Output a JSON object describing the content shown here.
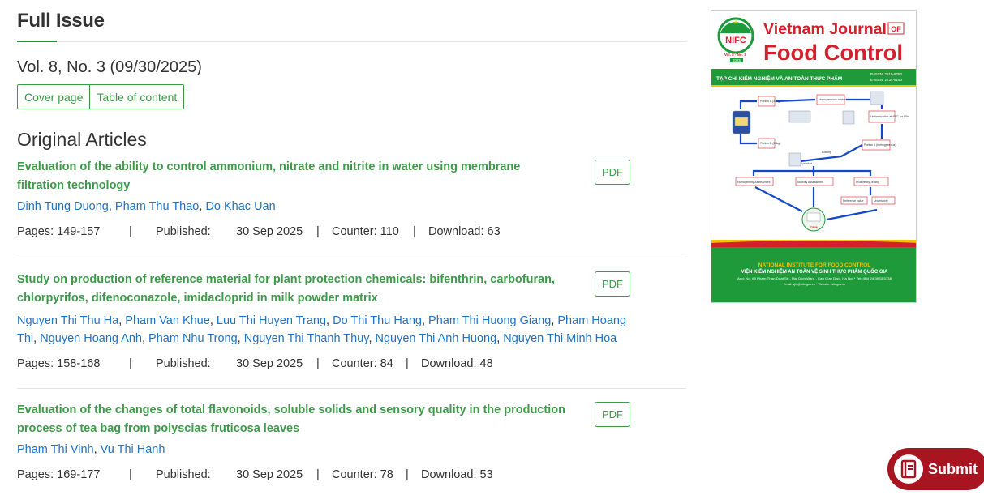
{
  "page": {
    "title": "Full Issue",
    "issue": "Vol. 8, No. 3 (09/30/2025)",
    "buttons": [
      "Cover page",
      "Table of content"
    ],
    "section": "Original Articles"
  },
  "labels": {
    "pdf": "PDF",
    "sep": "|",
    "published": "Published:",
    "pages_prefix": "Pages: ",
    "counter_prefix": "Counter: ",
    "download_prefix": "Download: "
  },
  "articles": [
    {
      "title": "Evaluation of the ability to control ammonium, nitrate and nitrite in water using membrane filtration technology",
      "authors": [
        "Dinh Tung Duong",
        "Pham Thu Thao",
        "Do Khac Uan"
      ],
      "pages": "149-157",
      "date": "30 Sep 2025",
      "counter": "110",
      "download": "63"
    },
    {
      "title": "Study on production of reference material for plant protection chemicals: bifenthrin, carbofuran, chlorpyrifos, difenoconazole, imidacloprid in milk powder matrix",
      "authors": [
        "Nguyen Thi Thu Ha",
        "Pham Van Khue",
        "Luu Thi Huyen Trang",
        "Do Thi Thu Hang",
        "Pham Thi Huong Giang",
        "Pham Hoang Thi",
        "Nguyen Hoang Anh",
        "Pham Nhu Trong",
        "Nguyen Thi Thanh Thuy",
        "Nguyen Thi Anh Huong",
        "Nguyen Thi Minh Hoa"
      ],
      "pages": "158-168",
      "date": "30 Sep 2025",
      "counter": "84",
      "download": "48"
    },
    {
      "title": "Evaluation of the changes of total flavonoids, soluble solids and sensory quality in the production process of tea bag from polyscias fruticosa leaves",
      "authors": [
        "Pham Thi Vinh",
        "Vu Thi Hanh"
      ],
      "pages": "169-177",
      "date": "30 Sep 2025",
      "counter": "78",
      "download": "53"
    }
  ],
  "cover": {
    "logo_text": "NIFC",
    "journal_line1": "Vietnam Journal",
    "journal_of": "OF",
    "journal_line2": "Food Control",
    "vol": "Vol. 8 - No. 3",
    "year": "2025",
    "vn_title": "TẠP CHÍ KIỂM NGHIỆM VÀ AN TOÀN THỰC PHẨM",
    "pissn": "P-ISSN: 2615-9252",
    "eissn": "E-ISSN: 2734-9160",
    "institute": "NATIONAL INSTITUTE FOR FOOD CONTROL",
    "institute_vn": "VIỆN KIỂM NGHIỆM AN TOÀN VỆ SINH THỰC PHẨM QUỐC GIA",
    "address": "Add: No. 65 Pham Than Duat Str., Mai Dich Ward., Cau Giay Dist., Ha Noi * Tel: (84) 24 3933 5738",
    "email": "Email: vjfc@nifc.gov.vn * Website: nifc.gov.vn",
    "diagram_labels": [
      "Portion A (300g)",
      "Homogeneous mixture",
      "Uniformization at 40°C for 60h",
      "Portion A (homogeneous)",
      "Portion B (50kg)",
      "Bottling",
      "Final product",
      "Homogeneity Assessment",
      "Stability Assessment",
      "Proficiency Testing",
      "Reference value",
      "Uncertainty",
      "CRM"
    ]
  },
  "submit": {
    "label": "Submit"
  },
  "colors": {
    "green": "#3d9a49",
    "link": "#1f73c4",
    "cover_green": "#1e9a3a",
    "cover_red": "#d4202c",
    "submit_red": "#a8141f"
  }
}
